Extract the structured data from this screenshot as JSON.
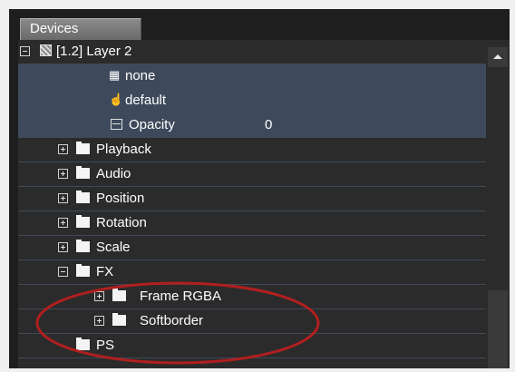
{
  "panel": {
    "tab_label": "Devices"
  },
  "tree": {
    "layer": {
      "label": "[1.2] Layer 2"
    },
    "props": [
      {
        "label": "none"
      },
      {
        "label": "default"
      },
      {
        "label": "Opacity",
        "value": "0"
      }
    ],
    "groups": [
      {
        "label": "Playback"
      },
      {
        "label": "Audio"
      },
      {
        "label": "Position"
      },
      {
        "label": "Rotation"
      },
      {
        "label": "Scale"
      },
      {
        "label": "FX"
      }
    ],
    "fx_children": [
      {
        "label": "Frame RGBA"
      },
      {
        "label": "Softborder"
      }
    ],
    "ps": {
      "label": "PS"
    }
  },
  "annotation": {
    "color": "#b01f1f"
  },
  "colors": {
    "selected_row": "#3e4a5c",
    "grid_line": "#3f4a58",
    "background": "#2b2b2b"
  }
}
